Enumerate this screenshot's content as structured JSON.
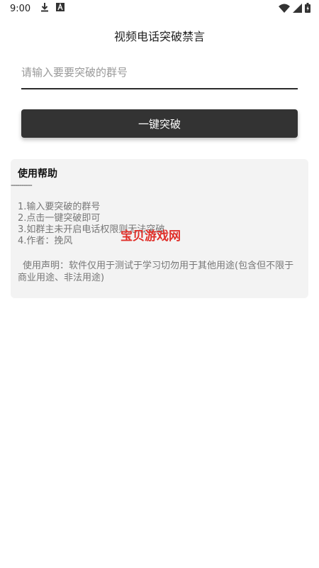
{
  "status_bar": {
    "time": "9:00",
    "icons": [
      "download-icon",
      "a-icon",
      "wifi-icon",
      "signal-icon",
      "battery-icon"
    ]
  },
  "header": {
    "title": "视频电话突破禁言"
  },
  "form": {
    "group_input": {
      "value": "",
      "placeholder": "请输入要要突破的群号"
    },
    "break_button_label": "一键突破"
  },
  "help": {
    "title": "使用帮助",
    "divider": "----------",
    "lines": [
      "1.输入要突破的群号",
      "2.点击一键突破即可",
      "3.如群主未开启电话权限则无法突破",
      "4.作者：挽风"
    ],
    "disclaimer": "使用声明：软件仅用于测试于学习切勿用于其他用途(包含但不限于商业用途、非法用途)"
  },
  "watermark": "宝贝游戏网",
  "colors": {
    "button_bg": "#333333",
    "panel_bg": "#f3f3f3",
    "watermark": "#e0302a"
  }
}
